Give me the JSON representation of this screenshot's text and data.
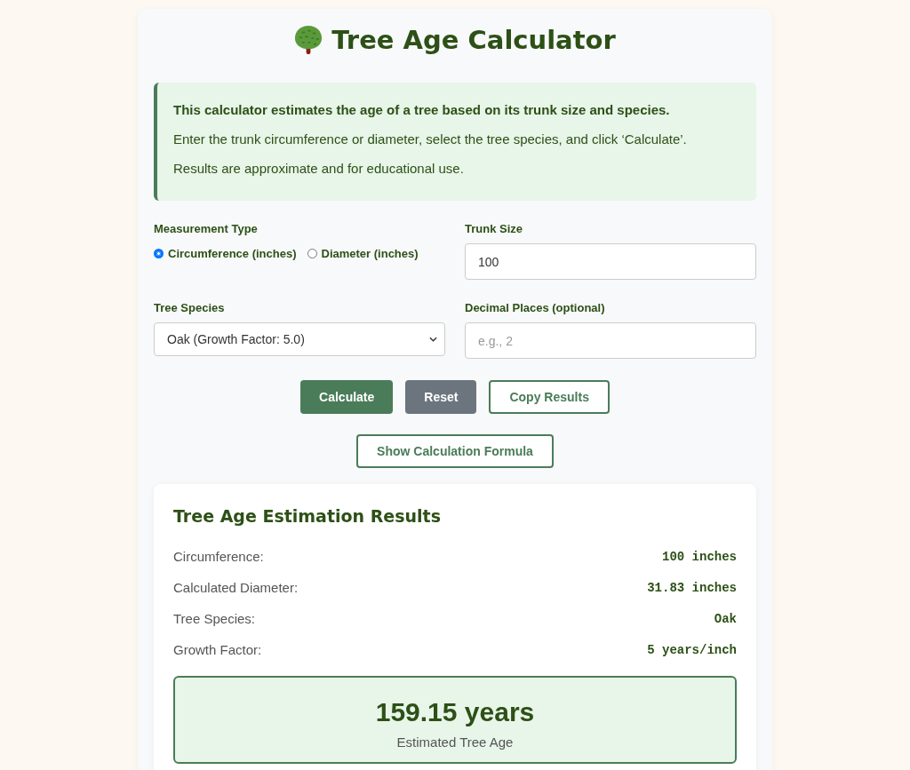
{
  "title": {
    "text": "Tree Age Calculator"
  },
  "intro": {
    "lead": "This calculator estimates the age of a tree based on its trunk size and species.",
    "lines": [
      "Enter the trunk circumference or diameter, select the tree species, and click ‘Calculate’.",
      "Results are approximate and for educational use."
    ]
  },
  "form": {
    "measurement_type": {
      "label": "Measurement Type",
      "options": [
        {
          "label": "Circumference (inches)",
          "selected": true
        },
        {
          "label": "Diameter (inches)",
          "selected": false
        }
      ]
    },
    "trunk_size": {
      "label": "Trunk Size",
      "value": "100"
    },
    "species": {
      "label": "Tree Species",
      "value": "Oak (Growth Factor: 5.0)"
    },
    "decimal_places": {
      "label": "Decimal Places (optional)",
      "placeholder": "e.g., 2"
    }
  },
  "buttons": [
    {
      "label": "Calculate",
      "kind": "primary"
    },
    {
      "label": "Reset",
      "kind": "secondary"
    },
    {
      "label": "Copy Results",
      "kind": "outline"
    }
  ],
  "formula_button": {
    "label": "Show Calculation Formula"
  },
  "results": {
    "title": "Tree Age Estimation Results",
    "rows": [
      {
        "label": "Circumference:",
        "value": "100 inches"
      },
      {
        "label": "Calculated Diameter:",
        "value": "31.83 inches"
      },
      {
        "label": "Tree Species:",
        "value": "Oak"
      },
      {
        "label": "Growth Factor:",
        "value": "5 years/inch"
      }
    ],
    "estimate": {
      "value": "159.15 years",
      "caption": "Estimated Tree Age"
    }
  }
}
